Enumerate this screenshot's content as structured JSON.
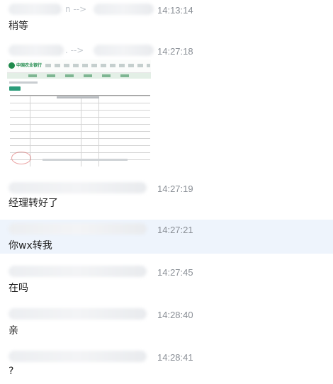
{
  "messages": [
    {
      "header_visible": "n -->",
      "time": "14:13:14",
      "text": "稍等"
    },
    {
      "header_visible": ". -->",
      "time": "14:27:18",
      "text": ""
    },
    {
      "header_visible": "",
      "time": "14:27:19",
      "text": "经理转好了"
    },
    {
      "header_visible": "",
      "time": "14:27:21",
      "text": "你wx转我"
    },
    {
      "header_visible": "",
      "time": "14:27:45",
      "text": "在吗"
    },
    {
      "header_visible": "",
      "time": "14:28:40",
      "text": "亲"
    },
    {
      "header_visible": "",
      "time": "14:28:41",
      "text": "?"
    }
  ],
  "receipt": {
    "bank_logo": "中国农业银行"
  }
}
